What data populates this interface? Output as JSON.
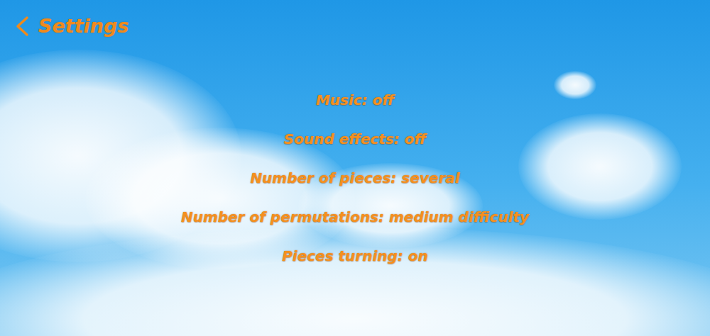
{
  "header": {
    "title": "Settings"
  },
  "settings": [
    {
      "text": "Music: off"
    },
    {
      "text": "Sound effects: off"
    },
    {
      "text": "Number of pieces: several"
    },
    {
      "text": "Number of permutations: medium difficulty"
    },
    {
      "text": "Pieces turning: on"
    }
  ]
}
